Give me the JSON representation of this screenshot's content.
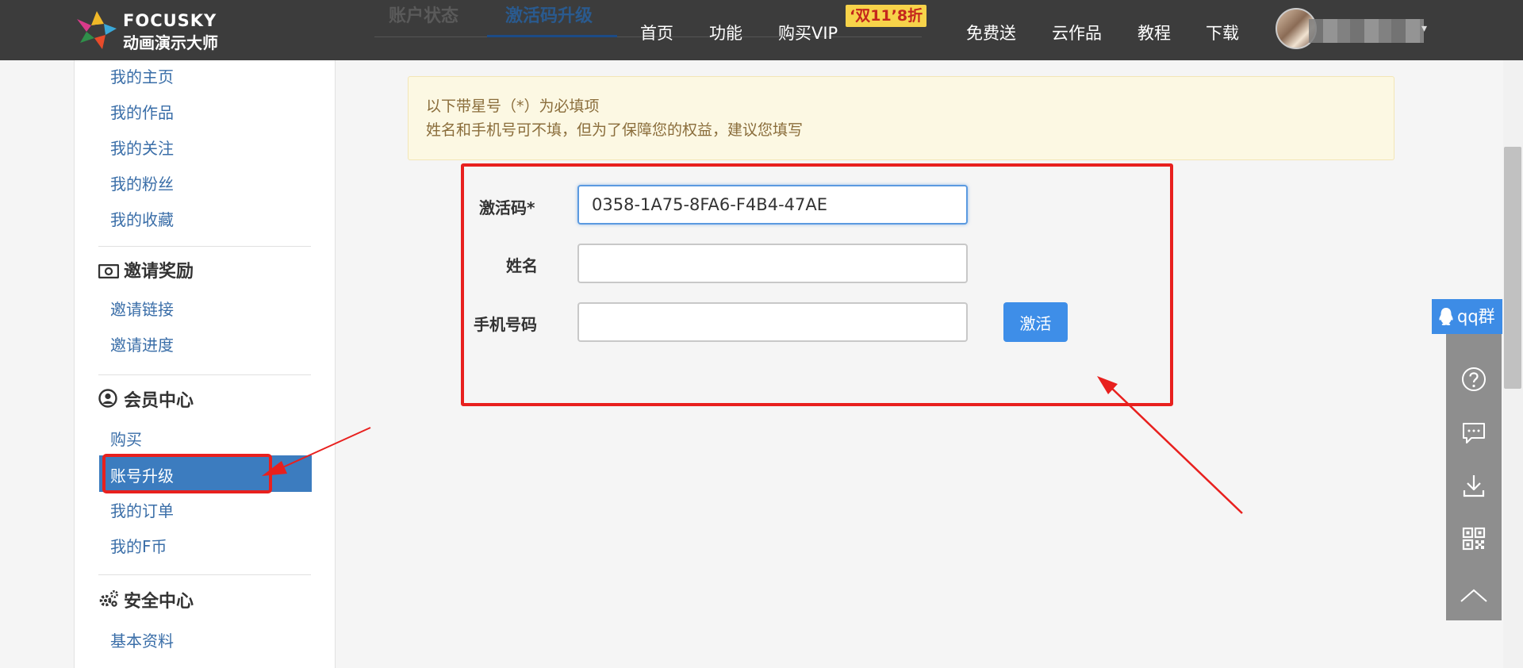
{
  "brand": {
    "name_en": "FOCUSKY",
    "name_cn": "动画演示大师"
  },
  "subtabs": [
    {
      "label": "账户状态"
    },
    {
      "label": "激活码升级"
    }
  ],
  "nav": {
    "items": [
      {
        "label": "首页"
      },
      {
        "label": "功能"
      },
      {
        "label": "购买VIP"
      },
      {
        "label": "免费送"
      },
      {
        "label": "云作品"
      },
      {
        "label": "教程"
      },
      {
        "label": "下载"
      }
    ],
    "promo": "‘双11’8折"
  },
  "sidebar": {
    "profile_links": [
      {
        "label": "我的主页"
      },
      {
        "label": "我的作品"
      },
      {
        "label": "我的关注"
      },
      {
        "label": "我的粉丝"
      },
      {
        "label": "我的收藏"
      }
    ],
    "invite": {
      "heading": "邀请奖励",
      "links": [
        {
          "label": "邀请链接"
        },
        {
          "label": "邀请进度"
        }
      ]
    },
    "member": {
      "heading": "会员中心",
      "links": [
        {
          "label": "购买"
        },
        {
          "label": "账号升级"
        },
        {
          "label": "我的订单"
        },
        {
          "label": "我的F币"
        }
      ]
    },
    "security": {
      "heading": "安全中心",
      "links": [
        {
          "label": "基本资料"
        }
      ]
    }
  },
  "notice": {
    "line1": "以下带星号（*）为必填项",
    "line2": "姓名和手机号可不填，但为了保障您的权益，建议您填写"
  },
  "form": {
    "code_label": "激活码*",
    "code_value": "0358-1A75-8FA6-F4B4-47AE",
    "name_label": "姓名",
    "name_value": "",
    "phone_label": "手机号码",
    "phone_value": "",
    "submit_label": "激活"
  },
  "float_bar": {
    "qq_label": "qq群",
    "icons": [
      "help-icon",
      "comment-icon",
      "download-icon",
      "qrcode-icon",
      "back-to-top-icon"
    ]
  },
  "colors": {
    "nav_bg": "#3c3c3c",
    "accent": "#3e8ee8",
    "sidebar_active": "#3c7cbf",
    "annotation": "#e8201e",
    "notice_bg": "#fcf8e3"
  }
}
